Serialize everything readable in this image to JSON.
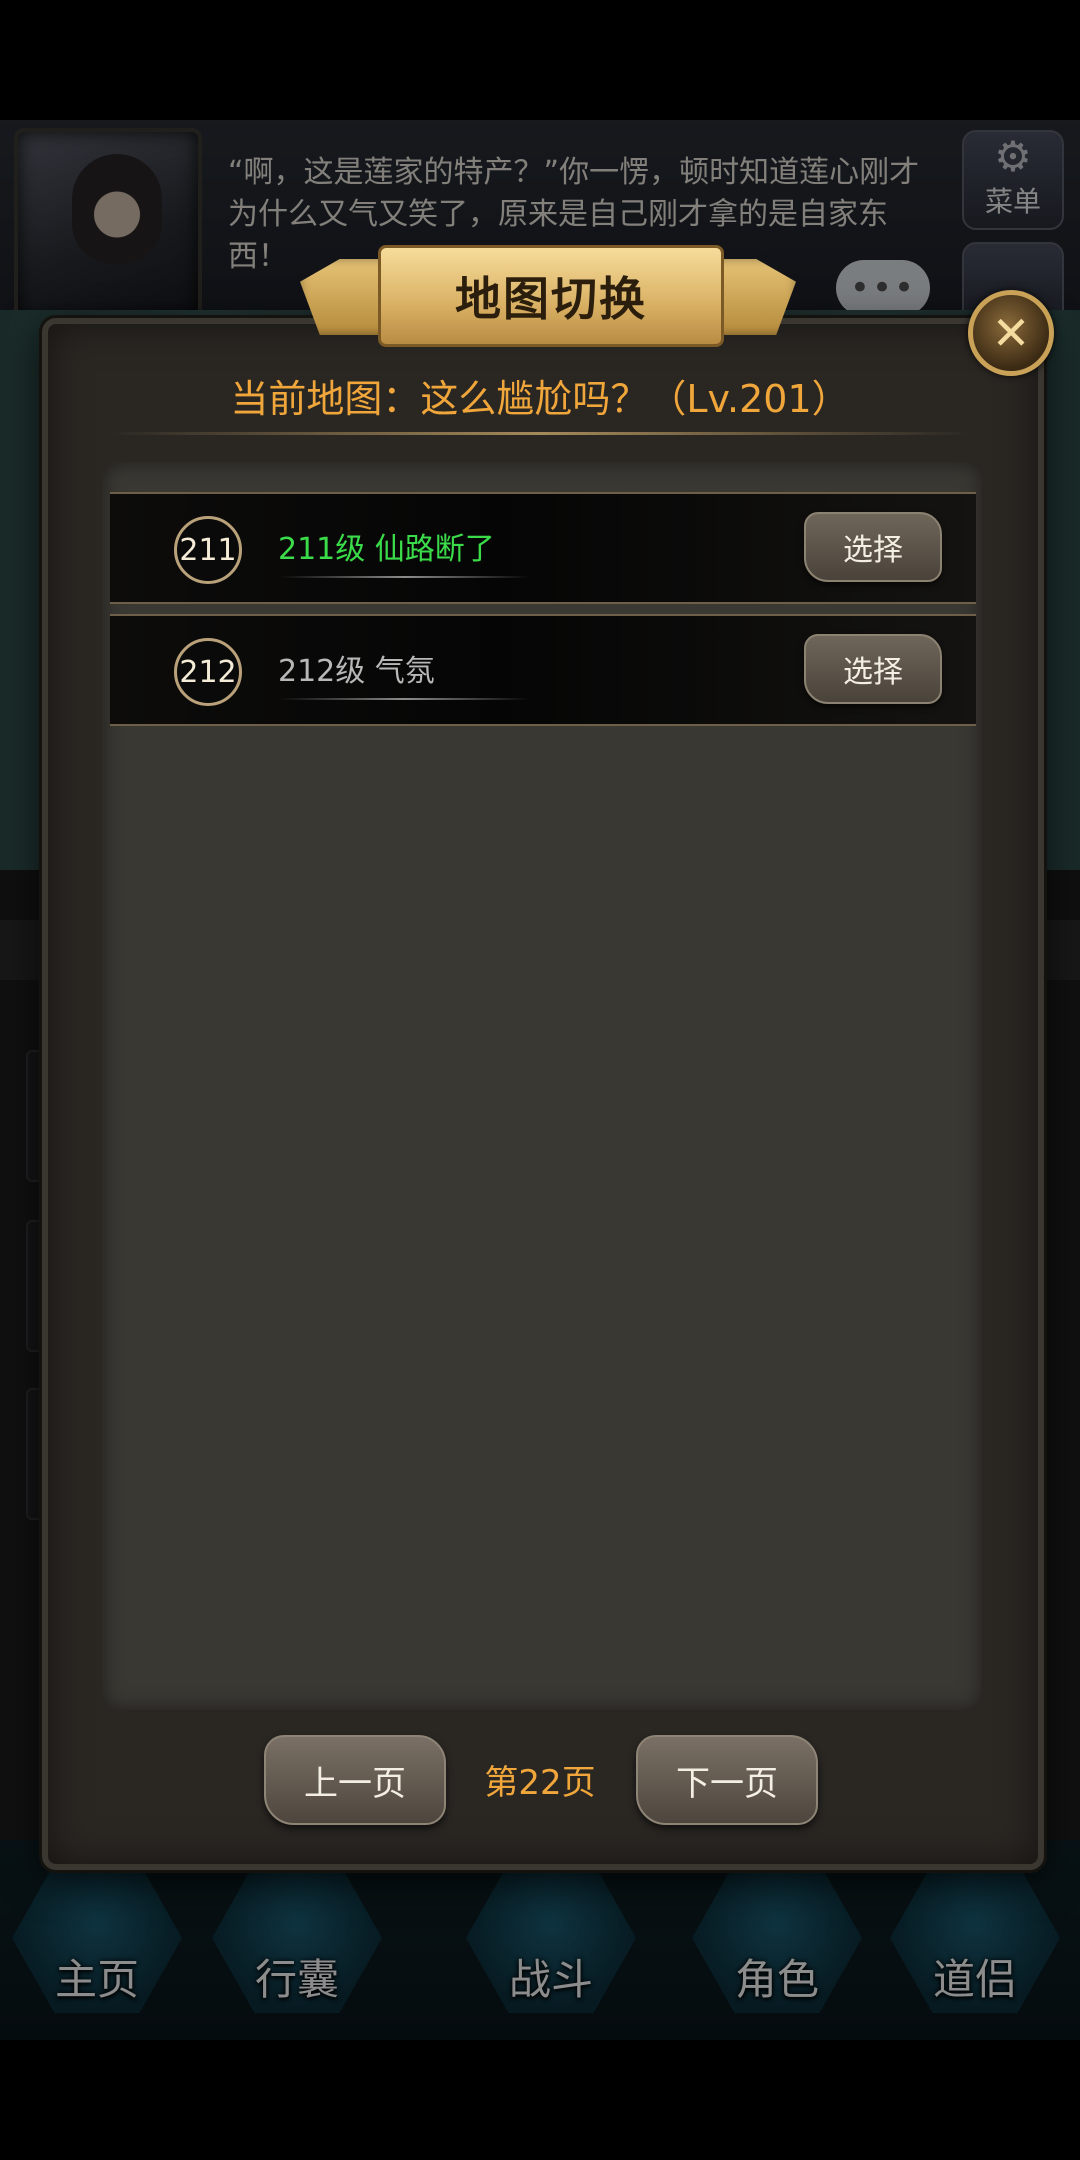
{
  "story": {
    "text": "“啊，这是莲家的特产？”你一愣，顿时知道莲心刚才为什么又气又笑了，原来是自己刚才拿的是自家东西！",
    "menu_label": "菜单",
    "menu_icon": "gear-icon",
    "chat_icon": "chat-bubble-icon"
  },
  "nav": {
    "home": "主页",
    "bag": "行囊",
    "battle": "战斗",
    "character": "角色",
    "partner": "道侣"
  },
  "dialog": {
    "title": "地图切换",
    "close_icon": "close-icon",
    "current_map": "当前地图：这么尴尬吗？（Lv.201）",
    "maps": [
      {
        "badge": "211",
        "name": "211级 仙路断了",
        "select": "选择",
        "color": "#3bdc4a"
      },
      {
        "badge": "212",
        "name": "212级 气氛",
        "select": "选择",
        "color": "#b8b8b8"
      }
    ],
    "prev_page": "上一页",
    "page": "第22页",
    "next_page": "下一页"
  },
  "colors": {
    "accent_orange": "#f0a63a",
    "available_green": "#3bdc4a",
    "locked_gray": "#b8b8b8"
  }
}
